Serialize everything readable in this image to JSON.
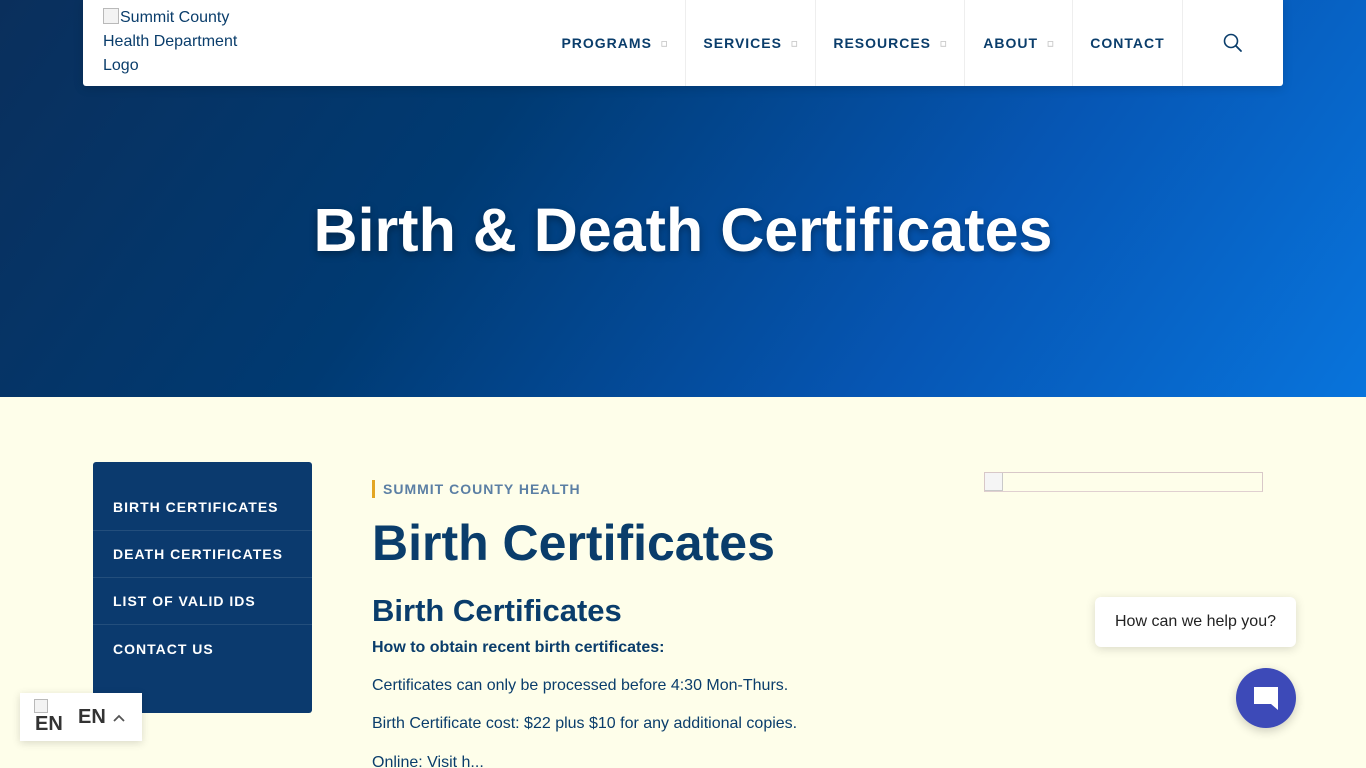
{
  "header": {
    "logo_alt": "Summit County Health Department Logo",
    "nav": [
      {
        "label": "PROGRAMS",
        "has_dropdown": true
      },
      {
        "label": "SERVICES",
        "has_dropdown": true
      },
      {
        "label": "RESOURCES",
        "has_dropdown": true
      },
      {
        "label": "ABOUT",
        "has_dropdown": true
      },
      {
        "label": "CONTACT",
        "has_dropdown": false
      }
    ],
    "search_icon": "search-icon"
  },
  "hero": {
    "title": "Birth & Death Certificates"
  },
  "sidebar": {
    "items": [
      {
        "label": "BIRTH CERTIFICATES"
      },
      {
        "label": "DEATH CERTIFICATES"
      },
      {
        "label": "LIST OF VALID IDS"
      },
      {
        "label": "CONTACT US"
      }
    ]
  },
  "main": {
    "eyebrow": "SUMMIT COUNTY HEALTH",
    "heading": "Birth Certificates",
    "subheading": "Birth Certificates",
    "bold_line": "How to obtain recent birth certificates:",
    "paragraphs": [
      "Certificates can only be processed before 4:30 Mon-Thurs.",
      "Birth Certificate cost: $22 plus $10 for any additional copies.",
      "Online: Visit h..."
    ]
  },
  "chat": {
    "prompt": "How can we help you?",
    "launcher_icon": "chat-icon"
  },
  "language": {
    "flag_alt": "EN",
    "code": "EN",
    "caret_icon": "chevron-up-icon"
  },
  "colors": {
    "primary_navy": "#0a3d6b",
    "sidebar_bg": "#0b3a6e",
    "accent_gold": "#e3a623",
    "chat_launcher": "#3d4ab8",
    "page_bg": "#fefeea"
  }
}
